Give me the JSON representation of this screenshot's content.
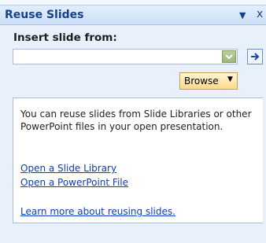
{
  "pane": {
    "title": "Reuse Slides",
    "menu_arrow": "▼",
    "close_glyph": "x"
  },
  "insert": {
    "label": "Insert slide from:",
    "value": ""
  },
  "browse": {
    "label": "Browse",
    "arrow": "▼"
  },
  "info": {
    "description": "You can reuse slides from Slide Libraries or other PowerPoint files in your open presentation.",
    "links": {
      "library": "Open a Slide Library",
      "powerpoint_file": "Open a PowerPoint File",
      "learn_more": "Learn more about reusing slides."
    }
  },
  "colors": {
    "title_text": "#15428b",
    "link": "#0b3cc1",
    "browse_bg": "#ffd98a",
    "combo_button": "#9bb77b"
  },
  "icons": {
    "dropdown": "chevron-down-icon",
    "go": "arrow-right-icon"
  }
}
